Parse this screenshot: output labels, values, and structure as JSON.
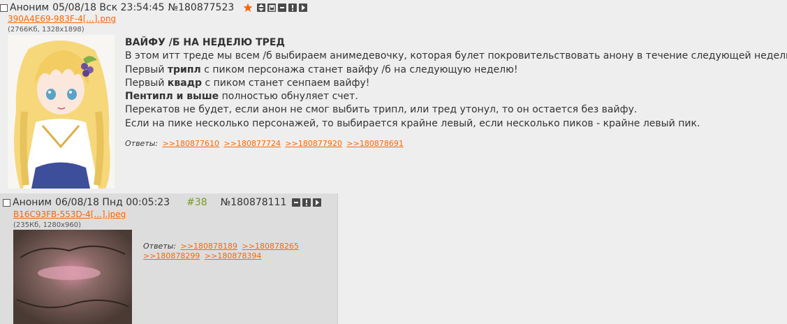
{
  "op": {
    "author": "Аноним",
    "date": "05/08/18 Вск 23:54:45",
    "post_number": "№180877523",
    "file_name": "390A4E69-983F-4[...].png",
    "file_meta": "(2766Кб, 1328x1898)",
    "title": "ВАЙФУ /Б НА НЕДЕЛЮ ТРЕД",
    "lines": [
      {
        "text": "В этом итт треде мы всем /б выбираем анимедевочку, которая булет покровительствовать анону в течение следующей недели."
      },
      {
        "before": "Первый ",
        "bold": "трипл",
        "after": " с пиком персонажа станет вайфу /б на следующую неделю!"
      },
      {
        "before": "Первый ",
        "bold": "квадр",
        "after": " с пиком станет сенпаем вайфу!"
      },
      {
        "before": "",
        "bold": "Пентипл и выше",
        "after": " полностью обнуляет счет."
      },
      {
        "text": "Перекатов не будет, если анон не смог выбить трипл, или тред утонул, то он остается без вайфу."
      },
      {
        "text": "Если на пике несколько персонажей, то выбирается крайне левый, если несколько пиков - крайне левый пик."
      }
    ],
    "replies_label": "Ответы:",
    "replies": [
      ">>180877610",
      ">>180877724",
      ">>180877920",
      ">>180878691"
    ]
  },
  "reply": {
    "author": "Аноним",
    "date": "06/08/18 Пнд 00:05:23",
    "post_index": "#38",
    "post_number": "№180878111",
    "file_name": "B16C93FB-553D-4[...].jpeg",
    "file_meta": "(235Кб, 1280x960)",
    "replies_label": "Ответы:",
    "replies": [
      ">>180878189",
      ">>180878265",
      ">>180878299",
      ">>180878394"
    ]
  },
  "colors": {
    "background": "#eeeeee",
    "reply_background": "#dddddd",
    "link": "#ff6600",
    "star": "#ff6600",
    "post_index": "#789922",
    "icon": "#4a4a4a"
  },
  "icons": [
    "star-icon",
    "expand-icon",
    "save-icon",
    "hide-icon",
    "report-icon",
    "play-icon"
  ]
}
